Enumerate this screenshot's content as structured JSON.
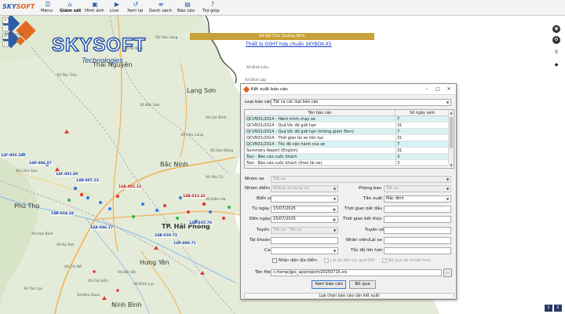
{
  "toolbar": {
    "logo_sky": "SKY",
    "logo_soft": "SOFT",
    "items": [
      {
        "label": "Menu",
        "icon": "☰"
      },
      {
        "label": "Giám sát",
        "icon": "⌂"
      },
      {
        "label": "Hình ảnh",
        "icon": "▣"
      },
      {
        "label": "Live",
        "icon": "▶"
      },
      {
        "label": "Xem lại",
        "icon": "↺"
      },
      {
        "label": "Danh sách",
        "icon": "≡"
      },
      {
        "label": "Báo cáo",
        "icon": "▤"
      },
      {
        "label": "Trợ giúp",
        "icon": "?"
      }
    ]
  },
  "map": {
    "logo_title": "SKYSOFT",
    "logo_subtitle": "Technologies",
    "status_banner": "Sở Bá Chũ, Quảng Ninh",
    "notice_link": "Thiết bị GSHT hợp chuẩn SKYBOX-X5",
    "places": {
      "thai_nguyen": "Thái Nguyên",
      "lang_son": "Lạng Sơn",
      "bac_ninh": "Bắc Ninh",
      "phu_tho": "Phú Thọ",
      "hai_phong": "TP. Hải Phòng",
      "hung_yen": "Hưng Yên",
      "ninh_binh": "Ninh Bình",
      "xa_tan_lac": "Xã Tân Lạc",
      "xa_vo_nhai": "Xã Võ Nhai",
      "xa_tan_tien": "Xã Tân Tiến",
      "xa_van_lang": "Xã Văn Lãng",
      "xa_loc_binh": "Xã Lộc Bình",
      "xa_dinh_lap": "Xã Đình Lập",
      "xa_huu_lung": "Xã Hữu Lũng",
      "xa_bac_son": "Xã Bắc Sơn",
      "xa_son_dong": "Xã Sơn Động",
      "xa_cam_son": "Xã Cẩm Sơn",
      "xa_hoa_binh": "Xã Hoà Bình",
      "xa_yen_tu": "Xã Yên Tử",
      "xa_ky_son": "Xã Kỳ Sơn",
      "xa_chi_ne": "Xã Chi Nê",
      "xa_gia_vien": "Xã Gia Viễn",
      "xa_nho_quan": "Xã Nho Quan",
      "xa_bac_bo": "Xã Bắc Bộ",
      "xa_binh_luc": "Xã Bình Lục",
      "xa_tan_lac_2": "Xã Tân Lạc",
      "xa_binh_lieu": "Xã Bình Liêu",
      "xa_dam_ha": "Xã Đầm Hà"
    },
    "vehicle_tags": [
      "14F-003.34",
      "14P-006.57",
      "14B-007.23",
      "14A-002.13",
      "14B-020.73",
      "14P-009.71",
      "14B-024.19",
      "14A-046.17",
      "14B-012.42",
      "14B-035.70",
      "14F-001.80"
    ],
    "controls": [
      "+",
      "−",
      "⊙",
      "▢"
    ],
    "corner_boxes": [
      "1",
      "2"
    ]
  },
  "dialog": {
    "title": "Kết xuất báo cáo",
    "minimize": "–",
    "maximize": "□",
    "close": "✕",
    "report_type_label": "Loại báo cáo",
    "report_type_value": "Tất cả các loại báo cáo",
    "table": {
      "col_name": "Tên báo cáo",
      "col_days": "Số ngày xem",
      "rows": [
        {
          "name": "QCVN31/2014 - Hành trình chạy xe",
          "days": "7"
        },
        {
          "name": "QCVN31/2014 - Quá tốc độ giới hạn",
          "days": "31"
        },
        {
          "name": "QCVN31/2014 - Quá tốc độ giới hạn (không giám 5km)",
          "days": "7"
        },
        {
          "name": "QCVN31/2014 - Thời gian lái xe liên tục",
          "days": "31"
        },
        {
          "name": "QCVN31/2014 - Tốc độ vận hành của xe",
          "days": "7"
        },
        {
          "name": "Summary Report (English)",
          "days": "31"
        },
        {
          "name": "Taxi - Báo cáo cuốc khách",
          "days": "3"
        },
        {
          "name": "Taxi - Báo cáo cuốc khách (theo lái xe)",
          "days": "3"
        }
      ]
    },
    "fields": {
      "vehicle_group_label": "Nhóm xe",
      "vehicle_group_value": "Tất cả",
      "location_group_label": "Nhóm điểm",
      "location_group_value": "Không sử dụng lọc",
      "department_label": "Phòng ban",
      "department_value": "Tất cả",
      "plate_label": "Biển số",
      "frequency_label": "Tần xuất",
      "frequency_value": "Mặc định",
      "from_date_label": "Từ ngày",
      "from_date_value": "15/07/2025",
      "start_time_label": "Thời gian bắt đầu",
      "to_date_label": "Đến ngày",
      "to_date_value": "15/07/2025",
      "end_time_label": "Thời gian kết thúc",
      "route_label": "Tuyến",
      "route_value": "Tất cả - Tất cả",
      "route_no_label": "Tuyến số",
      "account_label": "Tài khoản",
      "staff_label": "Nhân viên/Lái xe",
      "shift_label": "Ca",
      "max_speed_label": "Tốc độ lớn hơn"
    },
    "checks": {
      "location_name": "Nhận diện địa điểm",
      "continuous_driving": "Lái xe liên tục quá 04h",
      "skip_bad_accounts": "Bỏ qua tài khoản test"
    },
    "file_label": "Tên file",
    "file_value": "c:/temp/gps_app/report/20250715.xls",
    "browse_label": "...",
    "view_button": "Xem báo cáo",
    "skip_button": "Bỏ qua",
    "status_text": "Lựa chọn báo cáo cần kết xuất"
  }
}
